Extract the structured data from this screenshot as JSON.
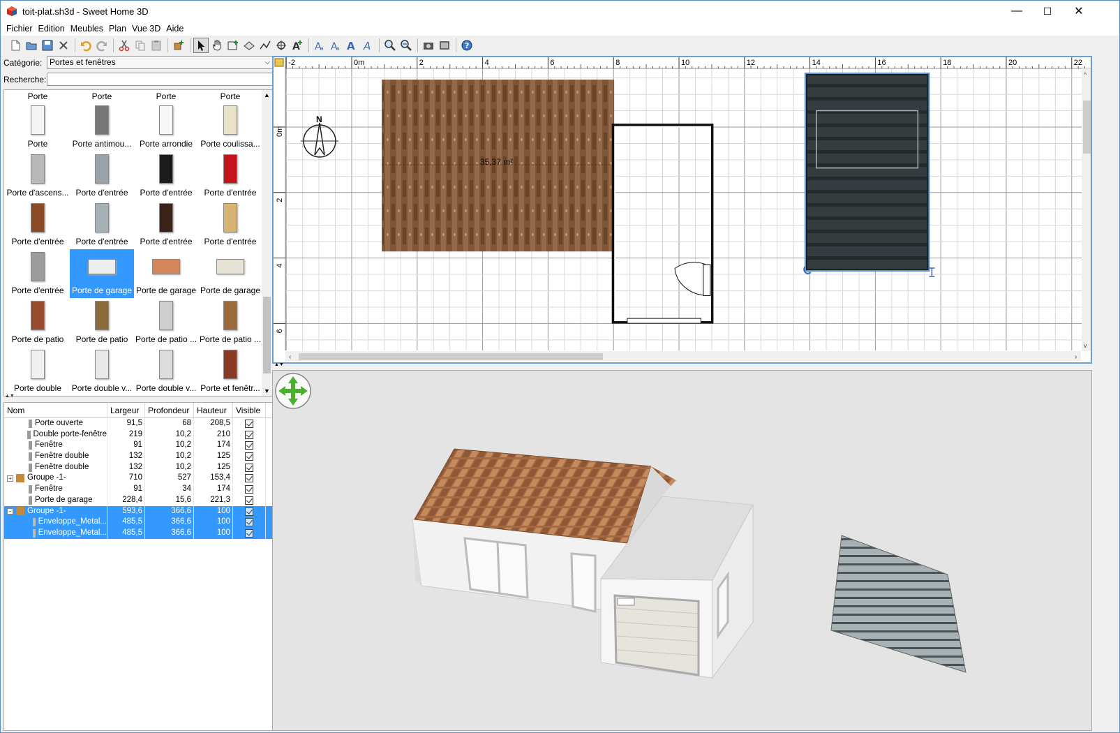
{
  "window": {
    "title": "toit-plat.sh3d - Sweet Home 3D",
    "minimize": "—",
    "maximize": "☐",
    "close": "✕"
  },
  "menu": [
    "Fichier",
    "Edition",
    "Meubles",
    "Plan",
    "Vue 3D",
    "Aide"
  ],
  "toolbar": {
    "icons": [
      "new-file",
      "open",
      "save",
      "cut-tool",
      "undo",
      "redo",
      "cut",
      "copy",
      "paste",
      "add-furniture",
      "select",
      "pan",
      "create-walls",
      "create-rooms",
      "create-polylines",
      "create-dimensions",
      "add-text",
      "text-style-1",
      "text-style-2",
      "text-style-3",
      "text-style-4",
      "zoom-in",
      "zoom-out",
      "photo",
      "video",
      "help"
    ],
    "active": "select"
  },
  "catalog": {
    "category_label": "Catégorie:",
    "category_value": "Portes et fenêtres",
    "search_label": "Recherche:",
    "search_value": "",
    "header_row": [
      "Porte",
      "Porte",
      "Porte",
      "Porte"
    ],
    "items": [
      {
        "label": "Porte",
        "color": "#f4f4f4"
      },
      {
        "label": "Porte antimou...",
        "color": "#777777"
      },
      {
        "label": "Porte arrondie",
        "color": "#f6f6f6"
      },
      {
        "label": "Porte coulissa...",
        "color": "#e9e2c9"
      },
      {
        "label": "Porte d'ascens...",
        "color": "#b8b8b8"
      },
      {
        "label": "Porte d'entrée",
        "color": "#9aa3a8"
      },
      {
        "label": "Porte d'entrée",
        "color": "#1c1c1c"
      },
      {
        "label": "Porte d'entrée",
        "color": "#c4131a"
      },
      {
        "label": "Porte d'entrée",
        "color": "#8a4a25"
      },
      {
        "label": "Porte d'entrée",
        "color": "#a7b0b4"
      },
      {
        "label": "Porte d'entrée",
        "color": "#3b2218"
      },
      {
        "label": "Porte d'entrée",
        "color": "#d8b472"
      },
      {
        "label": "Porte d'entrée",
        "color": "#9c9c9c"
      },
      {
        "label": "Porte de garage",
        "color": "#eeeeee"
      },
      {
        "label": "Porte de garage",
        "color": "#d4855a"
      },
      {
        "label": "Porte de garage",
        "color": "#e6e2d5"
      },
      {
        "label": "Porte de patio",
        "color": "#9a4a2c"
      },
      {
        "label": "Porte de patio",
        "color": "#8a6a3a"
      },
      {
        "label": "Porte de patio ...",
        "color": "#cfcfcf"
      },
      {
        "label": "Porte de patio ...",
        "color": "#9a6a3a"
      },
      {
        "label": "Porte double",
        "color": "#f0f0f0"
      },
      {
        "label": "Porte double v...",
        "color": "#e8e8e8"
      },
      {
        "label": "Porte double v...",
        "color": "#dcdcdc"
      },
      {
        "label": "Porte et fenêtr...",
        "color": "#8a3a22"
      }
    ],
    "selected_index": 13
  },
  "furniture": {
    "columns": [
      "Nom",
      "Largeur",
      "Profondeur",
      "Hauteur",
      "Visible"
    ],
    "rows": [
      {
        "name": "Porte ouverte",
        "w": "91,5",
        "d": "68",
        "h": "208,5",
        "level": 1,
        "sel": false,
        "group": false
      },
      {
        "name": "Double porte-fenêtre",
        "w": "219",
        "d": "10,2",
        "h": "210",
        "level": 1,
        "sel": false,
        "group": false
      },
      {
        "name": "Fenêtre",
        "w": "91",
        "d": "10,2",
        "h": "174",
        "level": 1,
        "sel": false,
        "group": false
      },
      {
        "name": "Fenêtre double",
        "w": "132",
        "d": "10,2",
        "h": "125",
        "level": 1,
        "sel": false,
        "group": false
      },
      {
        "name": "Fenêtre double",
        "w": "132",
        "d": "10,2",
        "h": "125",
        "level": 1,
        "sel": false,
        "group": false
      },
      {
        "name": "Groupe -1-",
        "w": "710",
        "d": "527",
        "h": "153,4",
        "level": 0,
        "sel": false,
        "group": "+"
      },
      {
        "name": "Fenêtre",
        "w": "91",
        "d": "34",
        "h": "174",
        "level": 1,
        "sel": false,
        "group": false
      },
      {
        "name": "Porte de garage",
        "w": "228,4",
        "d": "15,6",
        "h": "221,3",
        "level": 1,
        "sel": false,
        "group": false
      },
      {
        "name": "Groupe -1-",
        "w": "593,6",
        "d": "366,6",
        "h": "100",
        "level": 0,
        "sel": true,
        "group": "−"
      },
      {
        "name": "Enveloppe_Metal...",
        "w": "485,5",
        "d": "366,6",
        "h": "100",
        "level": 2,
        "sel": true,
        "group": false
      },
      {
        "name": "Enveloppe_Metal...",
        "w": "485,5",
        "d": "366,6",
        "h": "100",
        "level": 2,
        "sel": true,
        "group": false
      }
    ]
  },
  "plan": {
    "ruler_x": [
      "-2",
      "0m",
      "2",
      "4",
      "6",
      "8",
      "10",
      "12",
      "14",
      "16",
      "18",
      "20",
      "22"
    ],
    "ruler_y": [
      "0m",
      "2",
      "4",
      "6"
    ],
    "room_area": "35,37 m²",
    "compass_label": "N"
  },
  "colors": {
    "selection": "#3399ff",
    "plan_border": "#6aa0d8",
    "roof_brown": "#8a5a3a",
    "roof_dark": "#2e3538"
  }
}
